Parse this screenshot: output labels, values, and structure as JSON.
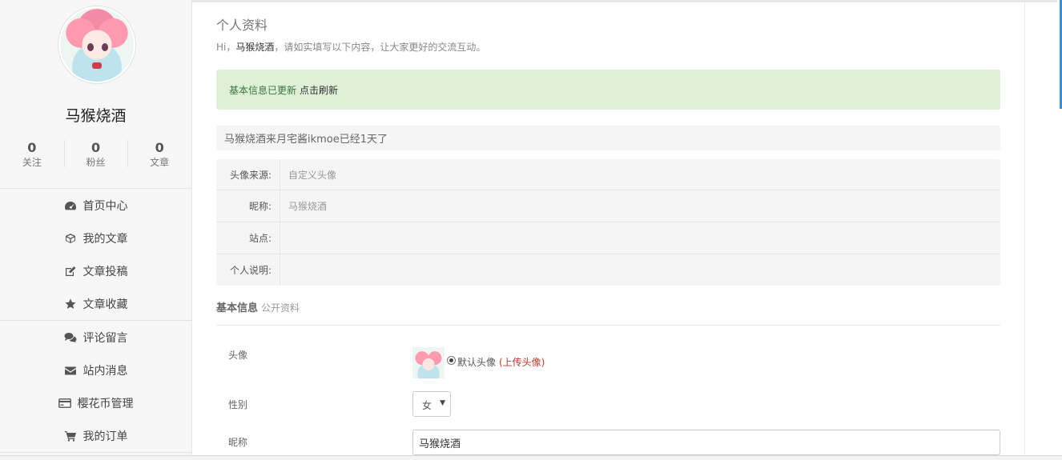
{
  "sidebar": {
    "username": "马猴烧酒",
    "stats": [
      {
        "num": "0",
        "label": "关注"
      },
      {
        "num": "0",
        "label": "粉丝"
      },
      {
        "num": "0",
        "label": "文章"
      }
    ],
    "nav": [
      {
        "label": "首页中心",
        "icon": "dashboard-icon"
      },
      {
        "label": "我的文章",
        "icon": "cube-icon"
      },
      {
        "label": "文章投稿",
        "icon": "edit-icon"
      },
      {
        "label": "文章收藏",
        "icon": "star-icon"
      },
      {
        "label": "评论留言",
        "icon": "comments-icon"
      },
      {
        "label": "站内消息",
        "icon": "envelope-icon"
      },
      {
        "label": "樱花币管理",
        "icon": "credit-card-icon"
      },
      {
        "label": "我的订单",
        "icon": "cart-icon"
      }
    ]
  },
  "main": {
    "title": "个人资料",
    "greeting_prefix": "Hi，",
    "greeting_name": "马猴烧酒",
    "greeting_suffix": "，请如实填写以下内容，让大家更好的交流互动。",
    "alert_text": "基本信息已更新",
    "alert_link": "点击刷新",
    "member_days": "马猴烧酒来月宅酱ikmoe已经1天了",
    "info_rows": [
      {
        "key": "头像来源:",
        "value": "自定义头像"
      },
      {
        "key": "昵称:",
        "value": "马猴烧酒"
      },
      {
        "key": "站点:",
        "value": ""
      },
      {
        "key": "个人说明:",
        "value": ""
      }
    ],
    "section_title": "基本信息",
    "section_sub": "公开资料",
    "form": {
      "avatar_label": "头像",
      "radio_label": "默认头像",
      "upload_link": "(上传头像)",
      "gender_label": "性别",
      "gender_value": "女",
      "nickname_label": "昵称",
      "nickname_value": "马猴烧酒"
    }
  },
  "colors": {
    "alert_bg": "#dff0d8",
    "alert_text": "#3c763d",
    "upload_link": "#c0392b",
    "scroll_accent": "#3a8ee6"
  }
}
